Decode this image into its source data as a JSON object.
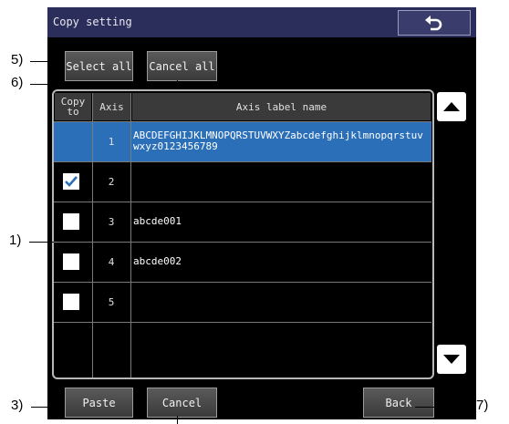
{
  "title": "Copy setting",
  "header_buttons": {
    "select_all": "Select all",
    "cancel_all": "Cancel all"
  },
  "table": {
    "columns": [
      "Copy to",
      "Axis",
      "Axis label name"
    ],
    "rows": [
      {
        "axis": "1",
        "name": "ABCDEFGHIJKLMNOPQRSTUVWXYZabcdefghijklmnopqrstuvwxyz0123456789",
        "checked": false,
        "selected": true,
        "has_checkbox": false
      },
      {
        "axis": "2",
        "name": "",
        "checked": true,
        "selected": false,
        "has_checkbox": true
      },
      {
        "axis": "3",
        "name": "abcde001",
        "checked": false,
        "selected": false,
        "has_checkbox": true
      },
      {
        "axis": "4",
        "name": "abcde002",
        "checked": false,
        "selected": false,
        "has_checkbox": true
      },
      {
        "axis": "5",
        "name": "",
        "checked": false,
        "selected": false,
        "has_checkbox": true
      },
      {
        "axis": "",
        "name": "",
        "checked": false,
        "selected": false,
        "has_checkbox": false
      }
    ]
  },
  "footer_buttons": {
    "paste": "Paste",
    "cancel": "Cancel",
    "back": "Back"
  },
  "callouts": [
    "1)",
    "3)",
    "5)",
    "6)",
    "7)"
  ],
  "colors": {
    "titlebar": "#2b2d5b",
    "selected_row": "#2a6fb8",
    "check": "#2a6fb8"
  }
}
